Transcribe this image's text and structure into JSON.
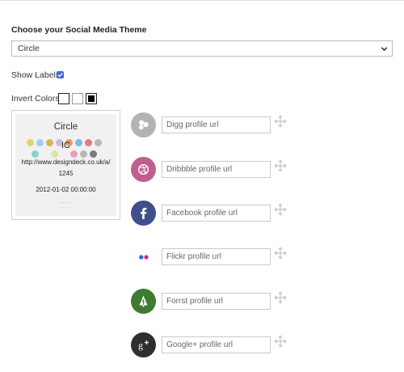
{
  "theme": {
    "label": "Choose your Social Media Theme",
    "selected": "Circle"
  },
  "show_labels": {
    "label": "Show Labels",
    "checked": true
  },
  "invert": {
    "label": "Invert Colors"
  },
  "preview": {
    "title": "Circle",
    "ic": "IC",
    "url": "http://www.designdeck.co.uk/a/",
    "num": "1245",
    "date": "2012-01-02 00:00:00"
  },
  "colors": {
    "accent_checkbox": "#3e6bd8",
    "digg": "#b3b3b3",
    "dribbble": "#c05f8e",
    "facebook": "#3f4e8c",
    "flickr_blue": "#2f5fd6",
    "flickr_pink": "#e0237d",
    "forrst": "#3e7a2f",
    "googleplus": "#2e2e2e"
  },
  "profiles": [
    {
      "icon": "digg-icon",
      "placeholder": "Digg profile url"
    },
    {
      "icon": "dribbble-icon",
      "placeholder": "Dribbble profile url"
    },
    {
      "icon": "facebook-icon",
      "placeholder": "Facebook profile url"
    },
    {
      "icon": "flickr-icon",
      "placeholder": "Flickr profile url"
    },
    {
      "icon": "forrst-icon",
      "placeholder": "Forrst profile url"
    },
    {
      "icon": "googleplus-icon",
      "placeholder": "Google+ profile url"
    }
  ]
}
